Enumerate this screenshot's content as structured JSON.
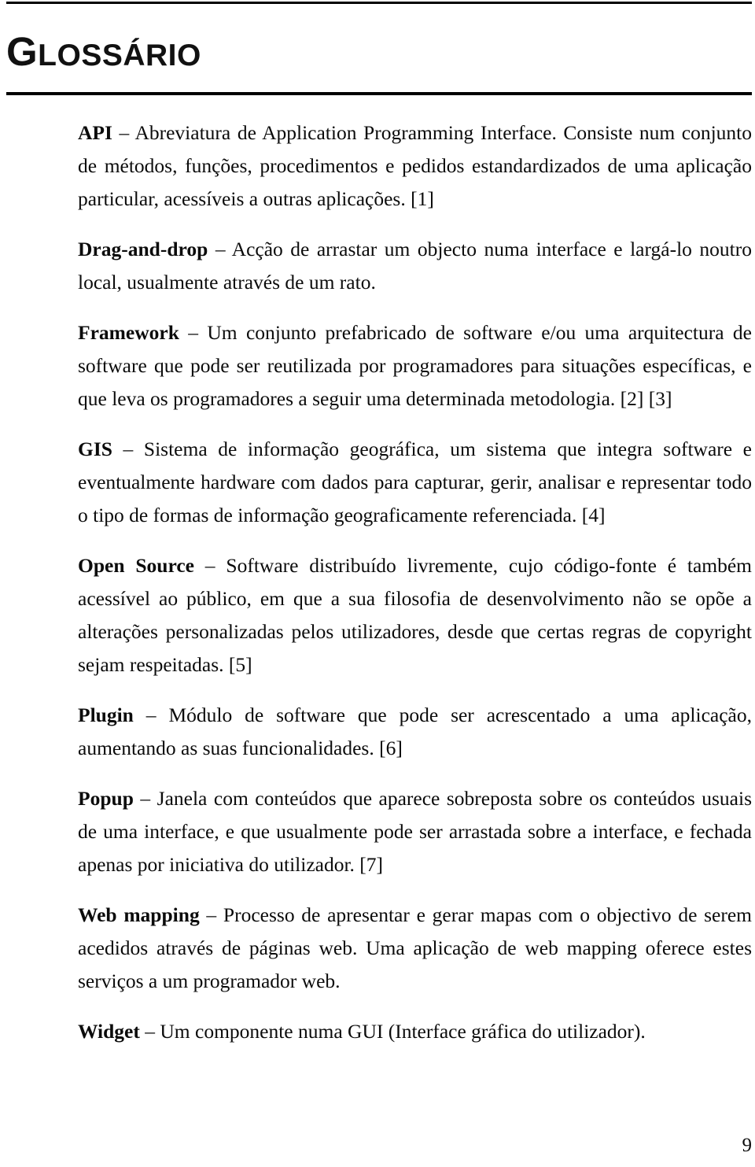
{
  "document": {
    "title": "GLOSSÁRIO",
    "title_first_letter": "G",
    "title_rest": "LOSSÁRIO",
    "page_number": "9"
  },
  "entries": [
    {
      "term": "API",
      "dash": " – ",
      "definition": "Abreviatura de Application Programming Interface. Consiste num conjunto de métodos, funções, procedimentos e pedidos estandardizados de uma aplicação particular, acessíveis a outras aplicações. [1]",
      "reference": "[1]"
    },
    {
      "term": "Drag-and-drop",
      "dash": " – ",
      "definition": "Acção de arrastar um objecto numa interface e largá-lo noutro local, usualmente através de um rato.",
      "reference": ""
    },
    {
      "term": "Framework",
      "dash": " – ",
      "definition": "Um conjunto prefabricado de software e/ou uma arquitectura de software que pode ser reutilizada por programadores para situações específicas, e que leva os programadores a seguir uma determinada metodologia. [2] [3]",
      "reference": "[2] [3]"
    },
    {
      "term": "GIS",
      "dash": " – ",
      "definition": "Sistema de informação geográfica, um sistema que integra software e eventualmente hardware com dados para capturar, gerir, analisar e representar todo o tipo de formas de informação geograficamente referenciada. [4]",
      "reference": "[4]"
    },
    {
      "term": "Open Source",
      "dash": " – ",
      "definition": "Software distribuído livremente, cujo código-fonte é também acessível ao público, em que a sua filosofia de desenvolvimento não se opõe a alterações personalizadas pelos utilizadores, desde que certas regras de copyright sejam respeitadas. [5]",
      "reference": "[5]"
    },
    {
      "term": "Plugin",
      "dash": " – ",
      "definition": "Módulo de software que pode ser acrescentado a uma aplicação, aumentando as suas funcionalidades. [6]",
      "reference": "[6]"
    },
    {
      "term": "Popup",
      "dash": " – ",
      "definition": "Janela com conteúdos que aparece sobreposta sobre os conteúdos usuais de uma interface, e que usualmente pode ser arrastada sobre a interface, e fechada apenas por iniciativa do utilizador. [7]",
      "reference": "[7]"
    },
    {
      "term": "Web mapping",
      "dash": " – ",
      "definition": "Processo de apresentar e gerar mapas com o objectivo de serem acedidos através de páginas web. Uma aplicação de web mapping oferece estes serviços a um programador web.",
      "reference": ""
    },
    {
      "term": "Widget",
      "dash": " – ",
      "definition": "Um componente numa GUI (Interface gráfica do utilizador).",
      "reference": ""
    }
  ]
}
